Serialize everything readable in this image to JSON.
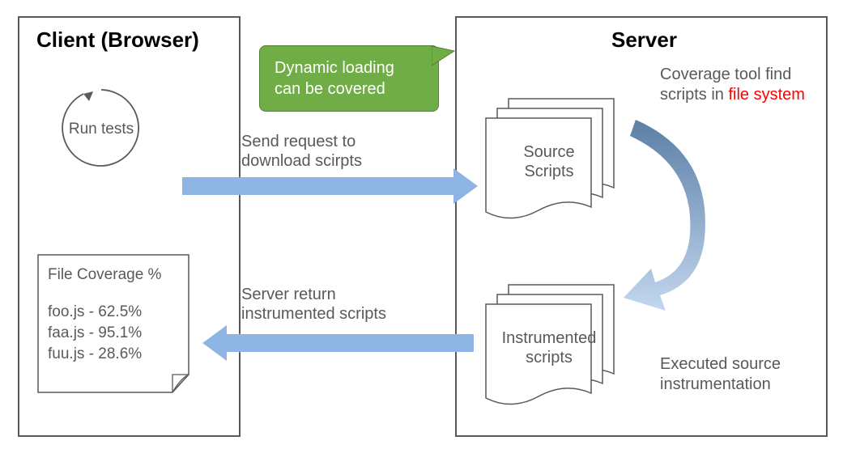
{
  "client_header": "Client (Browser)",
  "server_header": "Server",
  "run_tests_label": "Run tests",
  "callout_line1": "Dynamic loading",
  "callout_line2": "can be covered",
  "arrow1_line1": "Send request to",
  "arrow1_line2": "download scirpts",
  "arrow2_line1": "Server return",
  "arrow2_line2": "instrumented scripts",
  "stack1_line1": "Source",
  "stack1_line2": "Scripts",
  "stack2_line1": "Instrumented",
  "stack2_line2": "scripts",
  "right_text1_a": "Coverage tool find",
  "right_text1_b": "scripts in ",
  "right_text1_red": "file system",
  "right_text2_a": "Executed source",
  "right_text2_b": "instrumentation",
  "note_title": "File Coverage %",
  "note_row1": "foo.js - 62.5%",
  "note_row2": "faa.js - 95.1%",
  "note_row3": "fuu.js - 28.6%",
  "chart_data": {
    "type": "diagram",
    "nodes": [
      {
        "id": "client",
        "label": "Client (Browser)"
      },
      {
        "id": "runtests",
        "label": "Run tests",
        "parent": "client"
      },
      {
        "id": "coverage",
        "label": "File Coverage %",
        "parent": "client",
        "rows": [
          "foo.js - 62.5%",
          "faa.js - 95.1%",
          "fuu.js - 28.6%"
        ]
      },
      {
        "id": "server",
        "label": "Server"
      },
      {
        "id": "source",
        "label": "Source Scripts",
        "parent": "server"
      },
      {
        "id": "instrumented",
        "label": "Instrumented scripts",
        "parent": "server"
      }
    ],
    "edges": [
      {
        "from": "client",
        "to": "source",
        "label": "Send request to download scirpts"
      },
      {
        "from": "instrumented",
        "to": "client",
        "label": "Server return instrumented scripts"
      },
      {
        "from": "source",
        "to": "instrumented",
        "label": "Coverage tool find scripts in file system / Executed source instrumentation"
      }
    ],
    "annotations": [
      {
        "text": "Dynamic loading can be covered",
        "attached_to": "arrow client→source"
      }
    ]
  }
}
